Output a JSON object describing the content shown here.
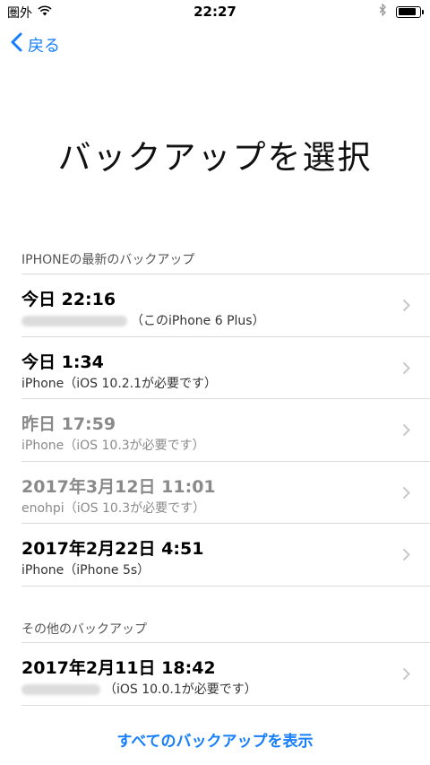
{
  "status_bar": {
    "carrier": "圏外",
    "time": "22:27"
  },
  "nav": {
    "back_label": "戻る"
  },
  "title": "バックアップを選択",
  "sections": {
    "latest_header": "IPHONEの最新のバックアップ",
    "other_header": "その他のバックアップ"
  },
  "latest_backups": [
    {
      "title": "今日 22:16",
      "detail": "（このiPhone 6 Plus）",
      "dimmed": false
    },
    {
      "title": "今日 1:34",
      "detail": "iPhone（iOS 10.2.1が必要です）",
      "dimmed": false
    },
    {
      "title": "昨日 17:59",
      "detail": "iPhone（iOS 10.3が必要です）",
      "dimmed": true
    },
    {
      "title": "2017年3月12日 11:01",
      "detail": "enohpi（iOS 10.3が必要です）",
      "dimmed": true
    },
    {
      "title": "2017年2月22日 4:51",
      "detail": "iPhone（iPhone 5s）",
      "dimmed": false
    }
  ],
  "other_backups": [
    {
      "title": "2017年2月11日 18:42",
      "detail": "（iOS 10.0.1が必要です）",
      "dimmed": false
    }
  ],
  "show_all_label": "すべてのバックアップを表示",
  "colors": {
    "accent": "#157efb",
    "dimmed_text": "#8a8a8a",
    "separator": "#d9d9d9"
  }
}
